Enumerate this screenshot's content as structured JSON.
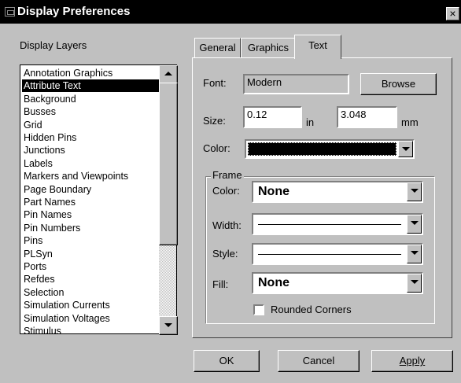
{
  "window": {
    "title": "Display Preferences",
    "close_glyph": "×"
  },
  "layers": {
    "label": "Display Layers",
    "items": [
      "Annotation Graphics",
      "Attribute Text",
      "Background",
      "Busses",
      "Grid",
      "Hidden Pins",
      "Junctions",
      "Labels",
      "Markers and Viewpoints",
      "Page Boundary",
      "Part Names",
      "Pin Names",
      "Pin Numbers",
      "Pins",
      "PLSyn",
      "Ports",
      "Refdes",
      "Selection",
      "Simulation Currents",
      "Simulation Voltages",
      "Stimulus"
    ],
    "selected": "Attribute Text"
  },
  "tabs": [
    {
      "label": "General",
      "active": false
    },
    {
      "label": "Graphics",
      "active": false
    },
    {
      "label": "Text",
      "active": true
    }
  ],
  "text_tab": {
    "font_label": "Font:",
    "font_value": "Modern",
    "browse_label": "Browse",
    "size_label": "Size:",
    "size_in": "0.12",
    "unit_in": "in",
    "size_mm": "3.048",
    "unit_mm": "mm",
    "color_label": "Color:",
    "color_value": "#000000",
    "frame": {
      "title": "Frame",
      "color_label": "Color:",
      "color_value": "None",
      "width_label": "Width:",
      "style_label": "Style:",
      "fill_label": "Fill:",
      "fill_value": "None",
      "rounded_label": "Rounded Corners",
      "rounded_checked": false
    }
  },
  "buttons": {
    "ok": "OK",
    "cancel": "Cancel",
    "apply": "Apply"
  }
}
